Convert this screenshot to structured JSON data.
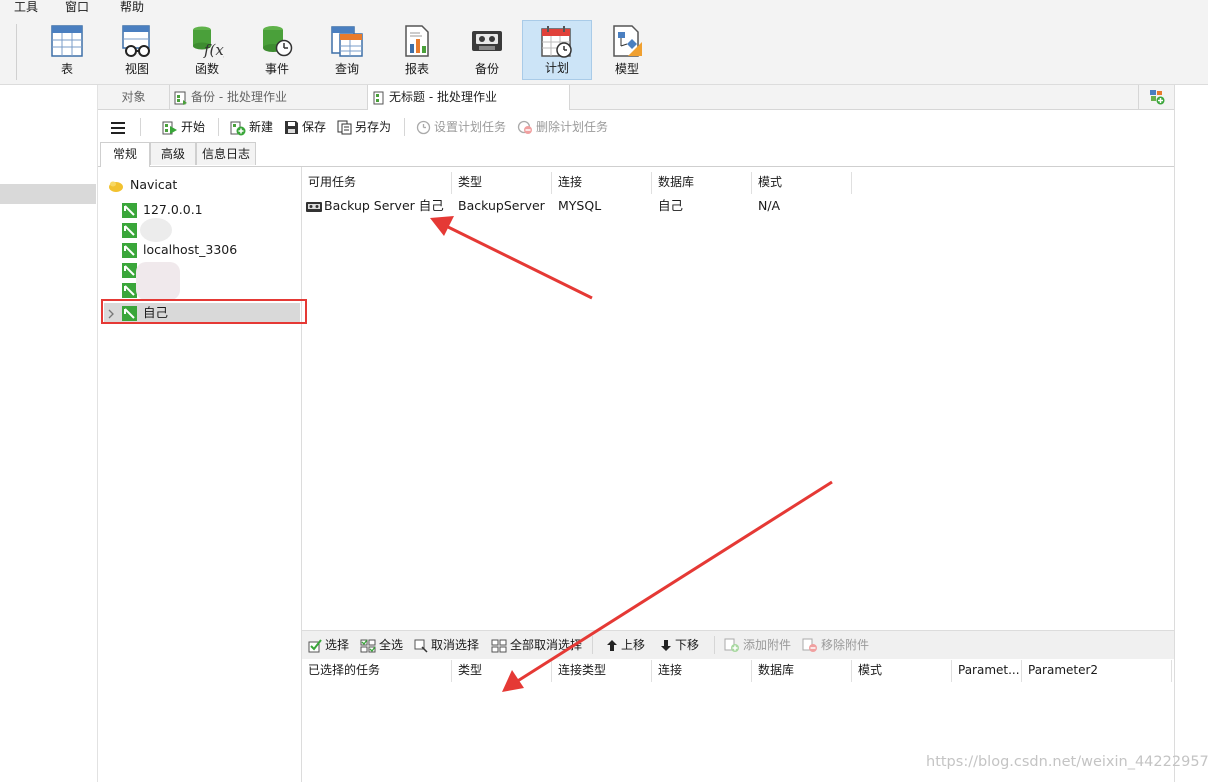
{
  "menu": [
    "工具",
    "窗口",
    "帮助"
  ],
  "ribbon": [
    {
      "label": "表",
      "icon": "table-icon"
    },
    {
      "label": "视图",
      "icon": "view-icon"
    },
    {
      "label": "函数",
      "icon": "function-icon"
    },
    {
      "label": "事件",
      "icon": "event-icon"
    },
    {
      "label": "查询",
      "icon": "query-icon"
    },
    {
      "label": "报表",
      "icon": "report-icon"
    },
    {
      "label": "备份",
      "icon": "backup-icon"
    },
    {
      "label": "计划",
      "icon": "schedule-icon",
      "active": true
    },
    {
      "label": "模型",
      "icon": "model-icon"
    }
  ],
  "tabs": {
    "objects": "对象",
    "backup_tab": "备份 - 批处理作业",
    "current_tab": "无标题 - 批处理作业"
  },
  "toolbar": {
    "start": "开始",
    "new": "新建",
    "save": "保存",
    "save_as": "另存为",
    "set_task": "设置计划任务",
    "delete_task": "删除计划任务"
  },
  "subtabs": [
    "常规",
    "高级",
    "信息日志"
  ],
  "tree": {
    "root": "Navicat",
    "connections": [
      "127.0.0.1",
      "",
      "localhost_3306",
      "",
      "",
      "自己"
    ],
    "selected": "自己"
  },
  "available": {
    "columns": [
      "可用任务",
      "类型",
      "连接",
      "数据库",
      "模式"
    ],
    "rows": [
      {
        "task": "Backup Server 自己",
        "type": "BackupServer",
        "connection": "MYSQL",
        "database": "自己",
        "schema": "N/A"
      }
    ]
  },
  "bottom_toolbar": {
    "select": "选择",
    "select_all": "全选",
    "deselect": "取消选择",
    "deselect_all": "全部取消选择",
    "move_up": "上移",
    "move_down": "下移",
    "add_attachment": "添加附件",
    "remove_attachment": "移除附件"
  },
  "selected_tasks": {
    "columns": [
      "已选择的任务",
      "类型",
      "连接类型",
      "连接",
      "数据库",
      "模式",
      "Paramet...",
      "Parameter2"
    ]
  },
  "watermark": "https://blog.csdn.net/weixin_44222957",
  "colors": {
    "accent": "#cce4f7",
    "annotation": "#e53935",
    "connection_green": "#3aa63a"
  }
}
